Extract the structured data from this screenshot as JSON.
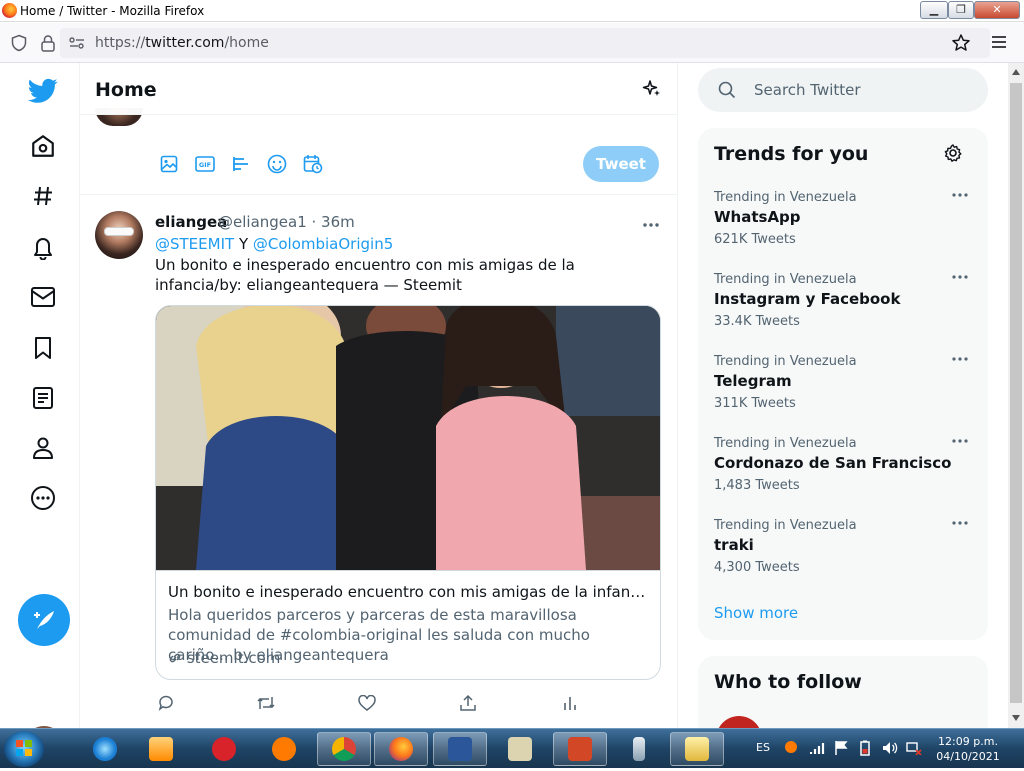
{
  "window": {
    "title": "Home / Twitter - Mozilla Firefox"
  },
  "browser": {
    "url_scheme": "https://",
    "url_host": "twitter.com",
    "url_path": "/home"
  },
  "feed": {
    "header_title": "Home",
    "tweet_button": "Tweet",
    "tweet": {
      "name": "eliangea",
      "handle": "@eliangea1 · 36m",
      "mention1": "@STEEMIT",
      "mention_joiner": " Y ",
      "mention2": "@ColombiaOrigin5",
      "text": "Un bonito e inesperado encuentro con mis amigas de la infancia/by: eliangeantequera — Steemit",
      "card": {
        "title": "Un bonito e inesperado encuentro con mis amigas de la infancia/by: e...",
        "description": "Hola queridos parceros y parceras de esta maravillosa comunidad de #colombia-original les saluda con mucho cariño... by eliangeantequera",
        "domain": "steemit.com"
      }
    }
  },
  "search": {
    "placeholder": "Search Twitter"
  },
  "trends": {
    "title": "Trends for you",
    "items": [
      {
        "context": "Trending in Venezuela",
        "name": "WhatsApp",
        "count": "621K Tweets"
      },
      {
        "context": "Trending in Venezuela",
        "name": "Instagram y Facebook",
        "count": "33.4K Tweets"
      },
      {
        "context": "Trending in Venezuela",
        "name": "Telegram",
        "count": "311K Tweets"
      },
      {
        "context": "Trending in Venezuela",
        "name": "Cordonazo de San Francisco",
        "count": "1,483 Tweets"
      },
      {
        "context": "Trending in Venezuela",
        "name": "traki",
        "count": "4,300 Tweets"
      }
    ],
    "show_more": "Show more"
  },
  "who_to_follow": {
    "title": "Who to follow"
  },
  "taskbar": {
    "language": "ES",
    "time": "12:09 p.m.",
    "date": "04/10/2021",
    "apps": [
      "internet-explorer-icon",
      "media-player-icon",
      "3g-icon",
      "avast-icon",
      "chrome-icon",
      "firefox-icon",
      "word-icon",
      "publisher-icon",
      "powerpoint-icon",
      "usb-icon",
      "file-explorer-icon"
    ]
  },
  "colors": {
    "accent": "#1d9bf0",
    "tweet_button_disabled": "#8ecdf8",
    "text": "#0f1419",
    "muted": "#536471"
  }
}
